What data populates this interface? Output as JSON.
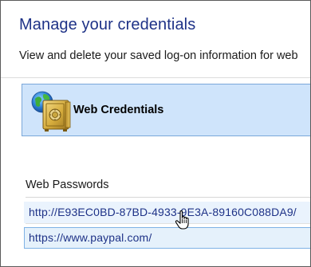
{
  "header": {
    "title": "Manage your credentials",
    "subtitle": "View and delete your saved log-on information for web"
  },
  "vault": {
    "label": "Web Credentials",
    "icon": "vault-safe-globe-icon",
    "selected": true
  },
  "web_passwords": {
    "section_label": "Web Passwords",
    "items": [
      {
        "url": "http://E93EC0BD-87BD-4933-9E3A-89160C088DA9/",
        "state": "hover"
      },
      {
        "url": "https://www.paypal.com/",
        "state": "selected"
      }
    ]
  },
  "colors": {
    "title": "#1e3287",
    "link": "#1e3287",
    "tile_bg": "#cfe4fb",
    "tile_border": "#7aa7d9",
    "row_hover_bg": "#eaf3fd",
    "row_selected_border": "#7fb2e5"
  },
  "cursor": "hand-pointer-icon"
}
